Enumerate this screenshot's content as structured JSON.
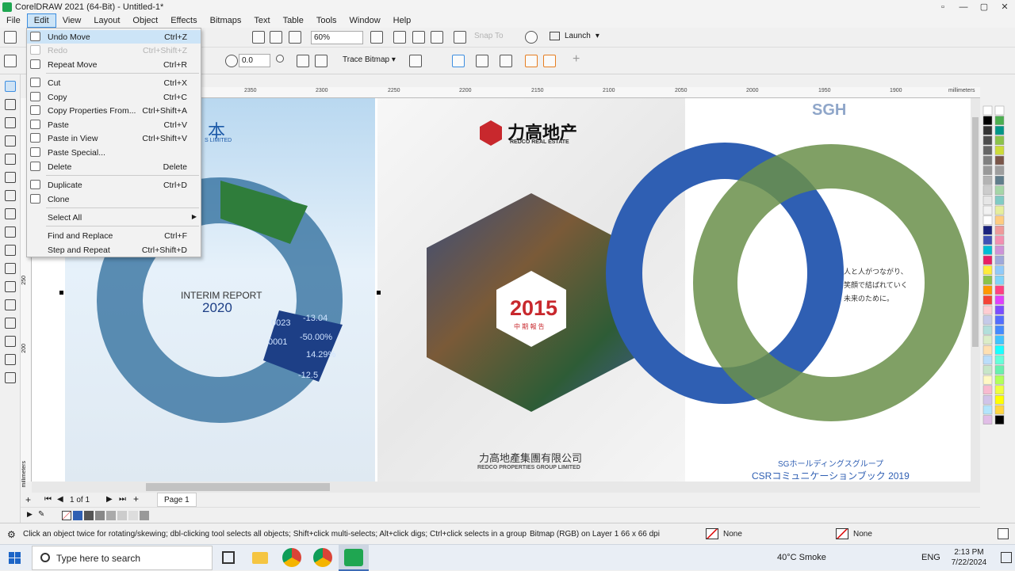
{
  "window": {
    "title": "CorelDRAW 2021 (64-Bit) - Untitled-1*"
  },
  "menubar": [
    "File",
    "Edit",
    "View",
    "Layout",
    "Object",
    "Effects",
    "Bitmaps",
    "Text",
    "Table",
    "Tools",
    "Window",
    "Help"
  ],
  "toolbar": {
    "zoom": "60%",
    "launch": "Launch",
    "snap_to": "Snap To",
    "rotation": "0.0",
    "trace_bitmap": "Trace Bitmap"
  },
  "edit_menu": {
    "items": [
      {
        "label": "Undo Move",
        "shortcut": "Ctrl+Z",
        "enabled": true
      },
      {
        "label": "Redo",
        "shortcut": "Ctrl+Shift+Z",
        "enabled": false
      },
      {
        "label": "Repeat Move",
        "shortcut": "Ctrl+R",
        "enabled": true
      },
      {
        "label": "Cut",
        "shortcut": "Ctrl+X",
        "enabled": true
      },
      {
        "label": "Copy",
        "shortcut": "Ctrl+C",
        "enabled": true
      },
      {
        "label": "Copy Properties From...",
        "shortcut": "Ctrl+Shift+A",
        "enabled": true
      },
      {
        "label": "Paste",
        "shortcut": "Ctrl+V",
        "enabled": true
      },
      {
        "label": "Paste in View",
        "shortcut": "Ctrl+Shift+V",
        "enabled": true
      },
      {
        "label": "Paste Special...",
        "shortcut": "",
        "enabled": true
      },
      {
        "label": "Delete",
        "shortcut": "Delete",
        "enabled": true
      },
      {
        "label": "Duplicate",
        "shortcut": "Ctrl+D",
        "enabled": true
      },
      {
        "label": "Clone",
        "shortcut": "",
        "enabled": true
      },
      {
        "label": "Select All",
        "shortcut": "",
        "enabled": true
      },
      {
        "label": "Find and Replace",
        "shortcut": "Ctrl+F",
        "enabled": true
      },
      {
        "label": "Step and Repeat",
        "shortcut": "Ctrl+Shift+D",
        "enabled": true
      }
    ]
  },
  "ruler": {
    "ticks": [
      "2350",
      "2300",
      "2250",
      "2200",
      "2150",
      "2100",
      "2050",
      "2000",
      "1950",
      "1900"
    ],
    "unit": "millimeters",
    "v_ticks": [
      "250",
      "200"
    ]
  },
  "canvas": {
    "panel1": {
      "title": "INTERIM REPORT",
      "year": "2020",
      "logo": "本",
      "logo_sub": "S LIMITED",
      "numbers": [
        "0023",
        "-13.04",
        "0001",
        "-50.00%",
        "14.29%",
        "-12.5"
      ]
    },
    "panel2": {
      "brand": "力高地产",
      "brand_en": "REDCO REAL ESTATE",
      "year": "2015",
      "sub": "中 期 報 告",
      "company": "力高地產集團有限公司",
      "company_en": "REDCO PROPERTIES GROUP LIMITED"
    },
    "panel3": {
      "logo": "SGH",
      "tagline_1": "人と人がつながり、",
      "tagline_2": "笑顔で結ばれていく",
      "tagline_3": "未来のために。",
      "footer_1": "SGホールディングスグループ",
      "footer_2": "CSRコミュニケーションブック 2019"
    }
  },
  "pages": {
    "count": "1 of 1",
    "tab": "Page 1"
  },
  "status": {
    "hint": "Click an object twice for rotating/skewing; dbl-clicking tool selects all objects; Shift+click multi-selects; Alt+click digs; Ctrl+click selects in a group",
    "object": "Bitmap (RGB) on Layer 1 66 x 66 dpi",
    "fill": "None",
    "outline": "None"
  },
  "taskbar": {
    "search": "Type here to search",
    "weather": "40°C  Smoke",
    "lang": "ENG",
    "time": "2:13 PM",
    "date": "7/22/2024"
  },
  "colors": {
    "accent": "#3d8ee0",
    "redco_red": "#c8282d",
    "sgh_blue": "#2f5fb3"
  }
}
